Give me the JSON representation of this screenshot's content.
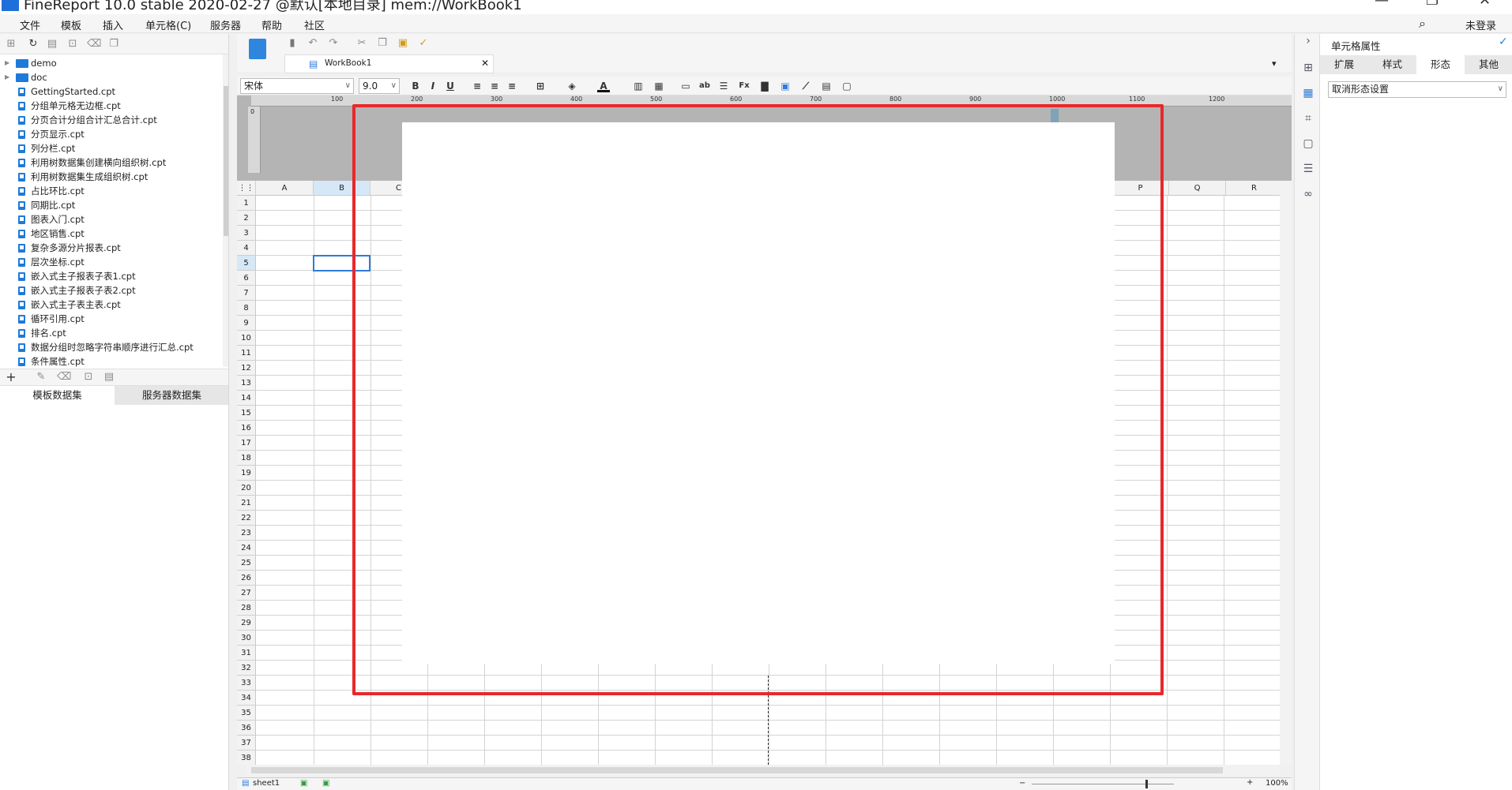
{
  "window": {
    "title": "FineReport 10.0 stable 2020-02-27 @默认[本地目录]    mem://WorkBook1"
  },
  "menu": [
    "文件",
    "模板",
    "插入",
    "单元格(C)",
    "服务器",
    "帮助",
    "社区"
  ],
  "account": {
    "login_label": "未登录"
  },
  "file_tree": {
    "folders": [
      "demo",
      "doc"
    ],
    "files": [
      "GettingStarted.cpt",
      "分组单元格无边框.cpt",
      "分页合计分组合计汇总合计.cpt",
      "分页显示.cpt",
      "列分栏.cpt",
      "利用树数据集创建横向组织树.cpt",
      "利用树数据集生成组织树.cpt",
      "占比环比.cpt",
      "同期比.cpt",
      "图表入门.cpt",
      "地区销售.cpt",
      "复杂多源分片报表.cpt",
      "层次坐标.cpt",
      "嵌入式主子报表子表1.cpt",
      "嵌入式主子报表子表2.cpt",
      "嵌入式主子表主表.cpt",
      "循环引用.cpt",
      "排名.cpt",
      "数据分组时忽略字符串顺序进行汇总.cpt",
      "条件属性.cpt"
    ]
  },
  "dataset_tabs": [
    "模板数据集",
    "服务器数据集"
  ],
  "editor_tab": {
    "label": "WorkBook1"
  },
  "format": {
    "font_name": "宋体",
    "font_size": "9.0"
  },
  "ruler_ticks": [
    "0",
    "100",
    "200",
    "300",
    "400",
    "500",
    "600",
    "700",
    "800",
    "900",
    "1000",
    "1100",
    "1200"
  ],
  "columns": [
    "A",
    "B",
    "C",
    "P",
    "Q",
    "R"
  ],
  "rows": [
    "1",
    "2",
    "3",
    "4",
    "5",
    "6",
    "7",
    "8",
    "9",
    "10",
    "11",
    "12",
    "13",
    "14",
    "15",
    "16",
    "17",
    "18",
    "19",
    "20",
    "21",
    "22",
    "23",
    "24",
    "25",
    "26",
    "27",
    "28",
    "29",
    "30",
    "31",
    "32",
    "33",
    "34",
    "35",
    "36",
    "37",
    "38"
  ],
  "sheet": {
    "name": "sheet1",
    "zoom": "100%"
  },
  "right_panel": {
    "title": "单元格属性",
    "tabs": [
      "扩展",
      "样式",
      "形态",
      "其他"
    ],
    "active_tab": "形态",
    "form_select_value": "取消形态设置"
  },
  "colors": {
    "accent": "#2e7bd8",
    "highlight": "#e8282b"
  }
}
